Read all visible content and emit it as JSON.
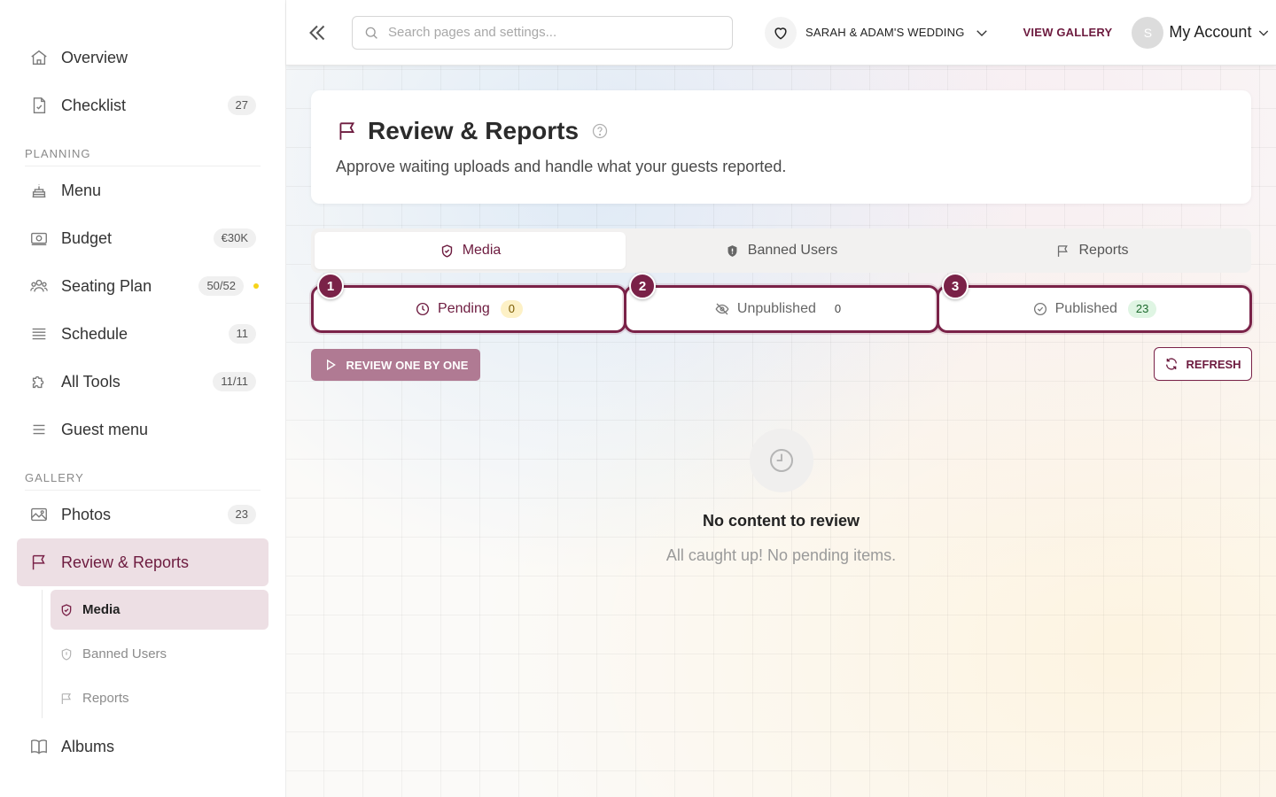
{
  "sidebar": {
    "items_top": [
      {
        "label": "Overview",
        "icon": "home-icon"
      },
      {
        "label": "Checklist",
        "icon": "checklist-icon",
        "badge": "27"
      }
    ],
    "planning_label": "PLANNING",
    "planning": [
      {
        "label": "Menu",
        "icon": "cake-icon"
      },
      {
        "label": "Budget",
        "icon": "money-icon",
        "badge": "€30K"
      },
      {
        "label": "Seating Plan",
        "icon": "people-icon",
        "badge": "50/52"
      },
      {
        "label": "Schedule",
        "icon": "schedule-icon",
        "badge": "11"
      },
      {
        "label": "All Tools",
        "icon": "puzzle-icon",
        "badge": "11/11"
      },
      {
        "label": "Guest menu",
        "icon": "menu-lines-icon"
      }
    ],
    "gallery_label": "GALLERY",
    "gallery": [
      {
        "label": "Photos",
        "icon": "image-icon",
        "badge": "23"
      },
      {
        "label": "Review & Reports",
        "icon": "flag-icon"
      }
    ],
    "sub": [
      {
        "label": "Media"
      },
      {
        "label": "Banned Users"
      },
      {
        "label": "Reports"
      }
    ],
    "albums": {
      "label": "Albums",
      "icon": "book-icon"
    }
  },
  "topbar": {
    "search_placeholder": "Search pages and settings...",
    "wedding_name": "SARAH & ADAM'S WEDDING",
    "view_gallery": "VIEW GALLERY",
    "avatar_initial": "S",
    "account_label": "My Account"
  },
  "page": {
    "title": "Review & Reports",
    "description": "Approve waiting uploads and handle what your guests reported."
  },
  "tabs": [
    {
      "label": "Media"
    },
    {
      "label": "Banned Users"
    },
    {
      "label": "Reports"
    }
  ],
  "status": [
    {
      "step": "1",
      "label": "Pending",
      "count": "0"
    },
    {
      "step": "2",
      "label": "Unpublished",
      "count": "0"
    },
    {
      "step": "3",
      "label": "Published",
      "count": "23"
    }
  ],
  "actions": {
    "review_one_by_one": "REVIEW ONE BY ONE",
    "refresh": "REFRESH"
  },
  "empty_state": {
    "title": "No content to review",
    "subtitle": "All caught up! No pending items."
  },
  "colors": {
    "accent": "#6d1b3f",
    "active_bg": "#eddfe4",
    "attention_dot": "#f5d31a"
  }
}
